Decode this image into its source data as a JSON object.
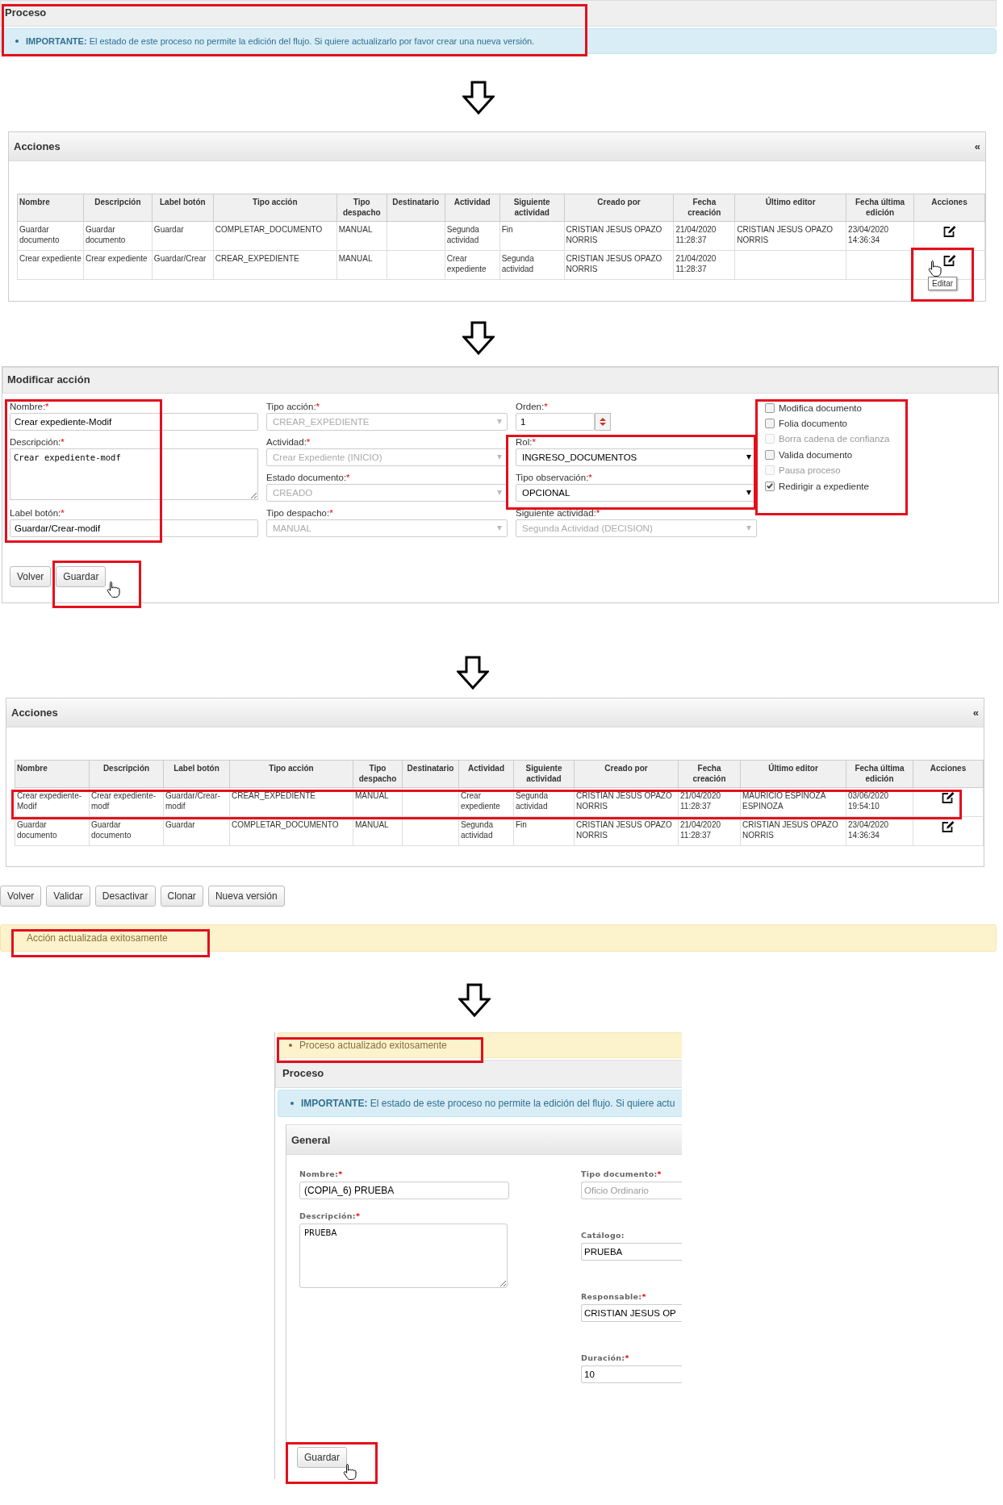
{
  "process_top": {
    "title": "Proceso",
    "notice": "**IMPORTANTE:** El estado de este proceso no permite la edición del flujo. Si quiere actualizarlo por favor crear una nueva versión."
  },
  "actions_before": {
    "title": "Acciones",
    "collapse": "«",
    "columns": [
      "Nombre",
      "Descripción",
      "Label botón",
      "Tipo acción",
      "Tipo despacho",
      "Destinatario",
      "Actividad",
      "Siguiente actividad",
      "Creado por",
      "Fecha creación",
      "Último editor",
      "Fecha última edición",
      "Acciones"
    ],
    "rows": [
      {
        "nombre": "Guardar documento",
        "descripcion": "Guardar documento",
        "label_boton": "Guardar",
        "tipo_accion": "COMPLETAR_DOCUMENTO",
        "tipo_despacho": "MANUAL",
        "actividad": "Segunda actividad",
        "siguiente_actividad": "Fin",
        "creado_por": "CRISTIAN JESUS OPAZO NORRIS",
        "fecha_creacion": "21/04/2020 11:28:37",
        "ultimo_editor": "CRISTIAN JESUS OPAZO NORRIS",
        "fecha_ultima_edicion": "23/04/2020 14:36:34"
      },
      {
        "nombre": "Crear expediente",
        "descripcion": "Crear expediente",
        "label_boton": "Guardar/Crear",
        "tipo_accion": "CREAR_EXPEDIENTE",
        "tipo_despacho": "MANUAL",
        "actividad": "Crear expediente",
        "siguiente_actividad": "Segunda actividad",
        "creado_por": "CRISTIAN JESUS OPAZO NORRIS",
        "fecha_creacion": "21/04/2020 11:28:37",
        "tooltip": "Editar"
      }
    ]
  },
  "edit_form": {
    "title": "Modificar acción",
    "columns": [
      [
        {
          "label": "Nombre:",
          "mark": "*",
          "kind": "text",
          "value": "Crear expediente-Modif",
          "disabled": false
        },
        {
          "label": "Descripción:",
          "mark": "*",
          "kind": "textarea",
          "value": "Crear expediente-modf",
          "disabled": false
        },
        {
          "label": "Label botón:",
          "mark": "*",
          "kind": "text",
          "value": "Guardar/Crear-modif",
          "disabled": false
        }
      ],
      [
        {
          "label": "Tipo acción:",
          "mark": "*",
          "kind": "select",
          "value": "CREAR_EXPEDIENTE",
          "disabled": true
        },
        {
          "label": "Actividad:",
          "mark": "*",
          "kind": "select",
          "value": "Crear Expediente (INICIO)",
          "disabled": true
        },
        {
          "label": "Estado documento:",
          "mark": "*",
          "kind": "select",
          "value": "CREADO",
          "disabled": true
        },
        {
          "label": "Tipo despacho:",
          "mark": "*",
          "kind": "select",
          "value": "MANUAL",
          "disabled": true
        }
      ],
      [
        {
          "label": "Orden:",
          "mark": "*",
          "kind": "number",
          "value": "1",
          "disabled": false
        },
        {
          "label": "Rol:",
          "mark": "*",
          "kind": "select",
          "value": "INGRESO_DOCUMENTOS",
          "disabled": false
        },
        {
          "label": "Tipo observación:",
          "mark": "*",
          "kind": "select",
          "value": "OPCIONAL",
          "disabled": false
        },
        {
          "label": "Siguiente actividad:",
          "mark": "*",
          "kind": "select",
          "value": "Segunda Actividad (DECISION)",
          "disabled": true
        }
      ]
    ],
    "checkboxes": [
      {
        "label": "Modifica documento",
        "checked": false,
        "disabled": false
      },
      {
        "label": "Folia documento",
        "checked": false,
        "disabled": false
      },
      {
        "label": "Borra cadena de confianza",
        "checked": false,
        "disabled": true
      },
      {
        "label": "Valida documento",
        "checked": false,
        "disabled": false
      },
      {
        "label": "Pausa proceso",
        "checked": false,
        "disabled": true
      },
      {
        "label": "Redirigir a expediente",
        "checked": true,
        "disabled": false
      }
    ],
    "buttons": [
      "Volver",
      "Guardar"
    ]
  },
  "actions_after": {
    "title": "Acciones",
    "collapse": "«",
    "columns": [
      "Nombre",
      "Descripción",
      "Label botón",
      "Tipo acción",
      "Tipo despacho",
      "Destinatario",
      "Actividad",
      "Siguiente actividad",
      "Creado por",
      "Fecha creación",
      "Último editor",
      "Fecha última edición",
      "Acciones"
    ],
    "rows": [
      {
        "nombre": "Crear expediente-Modif",
        "descripcion": "Crear expediente-modf",
        "label_boton": "Guardar/Crear-modif",
        "tipo_accion": "CREAR_EXPEDIENTE",
        "tipo_despacho": "MANUAL",
        "actividad": "Crear expediente",
        "siguiente_actividad": "Segunda actividad",
        "creado_por": "CRISTIAN JESUS OPAZO NORRIS",
        "fecha_creacion": "21/04/2020 11:28:37",
        "ultimo_editor": "MAURICIO ESPINOZA ESPINOZA",
        "fecha_ultima_edicion": "03/06/2020 19:54:10"
      },
      {
        "nombre": "Guardar documento",
        "descripcion": "Guardar documento",
        "label_boton": "Guardar",
        "tipo_accion": "COMPLETAR_DOCUMENTO",
        "tipo_despacho": "MANUAL",
        "actividad": "Segunda actividad",
        "siguiente_actividad": "Fin",
        "creado_por": "CRISTIAN JESUS OPAZO NORRIS",
        "fecha_creacion": "21/04/2020 11:28:37",
        "ultimo_editor": "CRISTIAN JESUS OPAZO NORRIS",
        "fecha_ultima_edicion": "23/04/2020 14:36:34"
      }
    ],
    "buttons": [
      "Volver",
      "Validar",
      "Desactivar",
      "Clonar",
      "Nueva versión"
    ],
    "message": "Acción actualizada exitosamente"
  },
  "process_after": {
    "message": "Proceso actualizado exitosamente",
    "title": "Proceso",
    "notice": "**IMPORTANTE:** El estado de este proceso no permite la edición del flujo. Si quiere actu",
    "section": "General",
    "left_fields": [
      {
        "label": "Nombre:",
        "mark": "*",
        "kind": "text",
        "value": "(COPIA_6) PRUEBA",
        "disabled": false
      },
      {
        "label": "Descripción:",
        "mark": "*",
        "kind": "textarea",
        "value": "PRUEBA",
        "disabled": false
      }
    ],
    "right_fields": [
      {
        "label": "Tipo documento:",
        "mark": "*",
        "kind": "text",
        "value": "Oficio Ordinario",
        "disabled": true
      },
      {
        "label": "Catálogo:",
        "kind": "text",
        "value": "PRUEBA",
        "disabled": false
      },
      {
        "label": "Responsable:",
        "mark": "*",
        "kind": "text",
        "value": "CRISTIAN JESUS OP",
        "disabled": false
      },
      {
        "label": "Duración:",
        "mark": "*",
        "kind": "text",
        "value": "10",
        "disabled": false
      }
    ],
    "button": "Guardar"
  }
}
